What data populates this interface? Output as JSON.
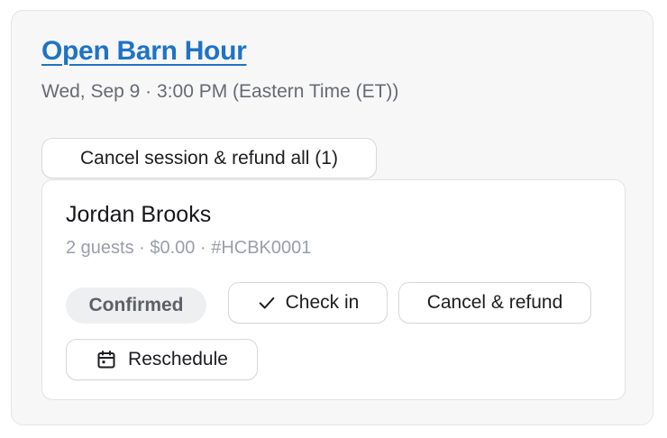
{
  "session": {
    "title": "Open Barn Hour",
    "datetime": "Wed, Sep 9 · 3:00 PM (Eastern Time (ET))",
    "cancel_all_label": "Cancel session & refund all (1)"
  },
  "booking": {
    "guest_name": "Jordan Brooks",
    "meta": "2 guests · $0.00 · #HCBK0001",
    "status": "Confirmed",
    "actions": {
      "checkin_label": "Check in",
      "checkin_icon": "check-icon",
      "cancel_refund_label": "Cancel & refund",
      "reschedule_label": "Reschedule",
      "reschedule_icon": "calendar-icon"
    }
  },
  "colors": {
    "title_link": "#1f73c6",
    "muted_text": "#666a72",
    "meta_text": "#9a9ea6",
    "badge_bg": "#eeeff1",
    "panel_bg": "#f7f7f8"
  }
}
